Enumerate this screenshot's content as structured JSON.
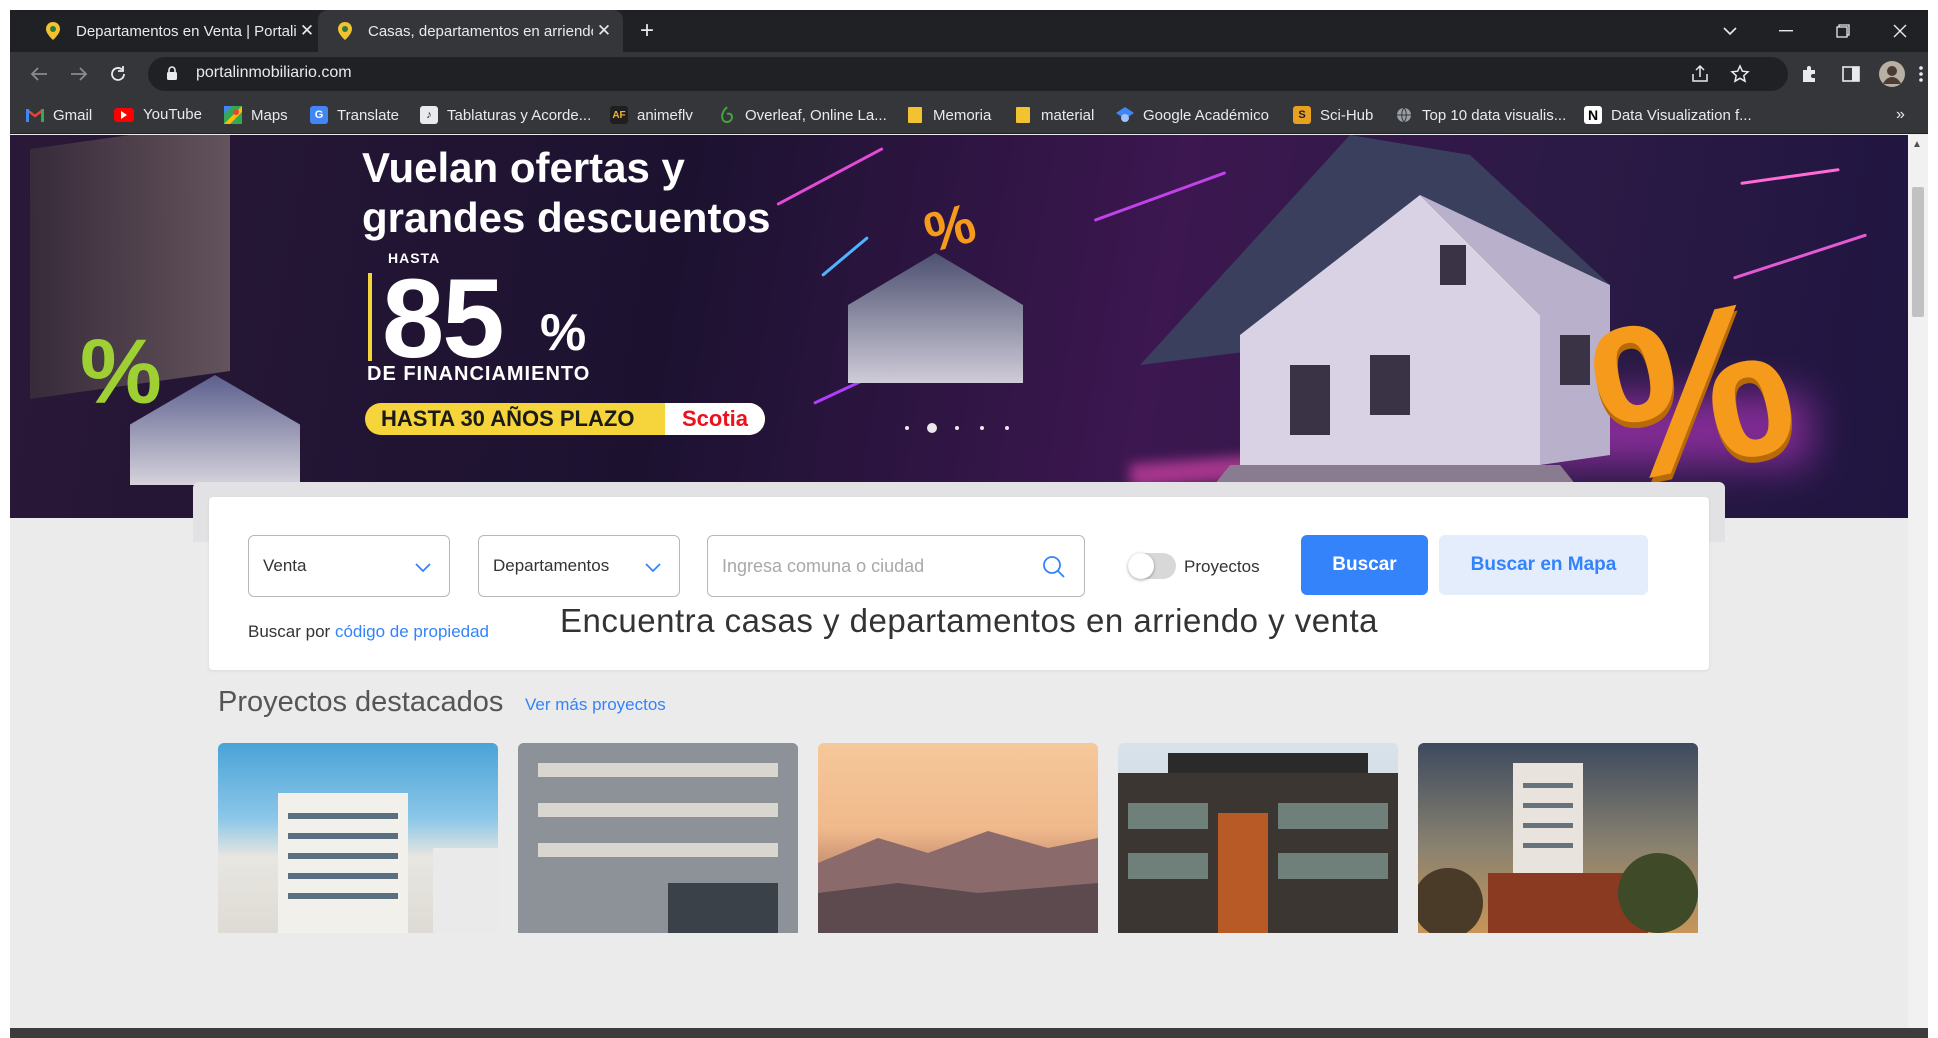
{
  "browser": {
    "tabs": [
      {
        "title": "Departamentos en Venta | Portalinmobiliario",
        "active": false
      },
      {
        "title": "Casas, departamentos en arriendo y venta",
        "active": true
      }
    ],
    "url": "portalinmobiliario.com",
    "bookmarks": [
      {
        "label": "Gmail",
        "icon": "gmail-icon"
      },
      {
        "label": "YouTube",
        "icon": "youtube-icon"
      },
      {
        "label": "Maps",
        "icon": "maps-icon"
      },
      {
        "label": "Translate",
        "icon": "translate-icon"
      },
      {
        "label": "Tablaturas y Acorde...",
        "icon": "tablaturas-icon"
      },
      {
        "label": "animeflv",
        "icon": "animeflv-icon"
      },
      {
        "label": "Overleaf, Online La...",
        "icon": "overleaf-icon"
      },
      {
        "label": "Memoria",
        "icon": "folder-icon"
      },
      {
        "label": "material",
        "icon": "folder-icon"
      },
      {
        "label": "Google Académico",
        "icon": "scholar-icon"
      },
      {
        "label": "Sci-Hub",
        "icon": "scihub-icon"
      },
      {
        "label": "Top 10 data visualis...",
        "icon": "globe-icon"
      },
      {
        "label": "Data Visualization f...",
        "icon": "notion-icon"
      }
    ],
    "bookmarks_overflow": "»"
  },
  "hero": {
    "headline_line1": "Vuelan ofertas y",
    "headline_line2": "grandes descuentos",
    "hasta": "HASTA",
    "percent_value": "85",
    "percent_sign": "%",
    "financing": "DE FINANCIAMIENTO",
    "term": "HASTA 30 AÑOS PLAZO",
    "brand": "Scotia",
    "deco_percent": "%",
    "carousel_slides": 5,
    "carousel_active_index": 1
  },
  "search": {
    "operation": "Venta",
    "property_type": "Departamentos",
    "location_placeholder": "Ingresa comuna o ciudad",
    "projects_toggle_label": "Proyectos",
    "projects_toggle_on": false,
    "search_button": "Buscar",
    "map_button": "Buscar en Mapa",
    "code_prefix": "Buscar por",
    "code_link": "código de propiedad"
  },
  "main": {
    "headline": "Encuentra casas y departamentos en arriendo y venta",
    "featured_title": "Proyectos destacados",
    "featured_link": "Ver más proyectos"
  },
  "colors": {
    "accent": "#3483fa",
    "accent_light": "#e3edfb",
    "hero_yellow": "#f6d43b",
    "scotia_red": "#ec111a"
  }
}
